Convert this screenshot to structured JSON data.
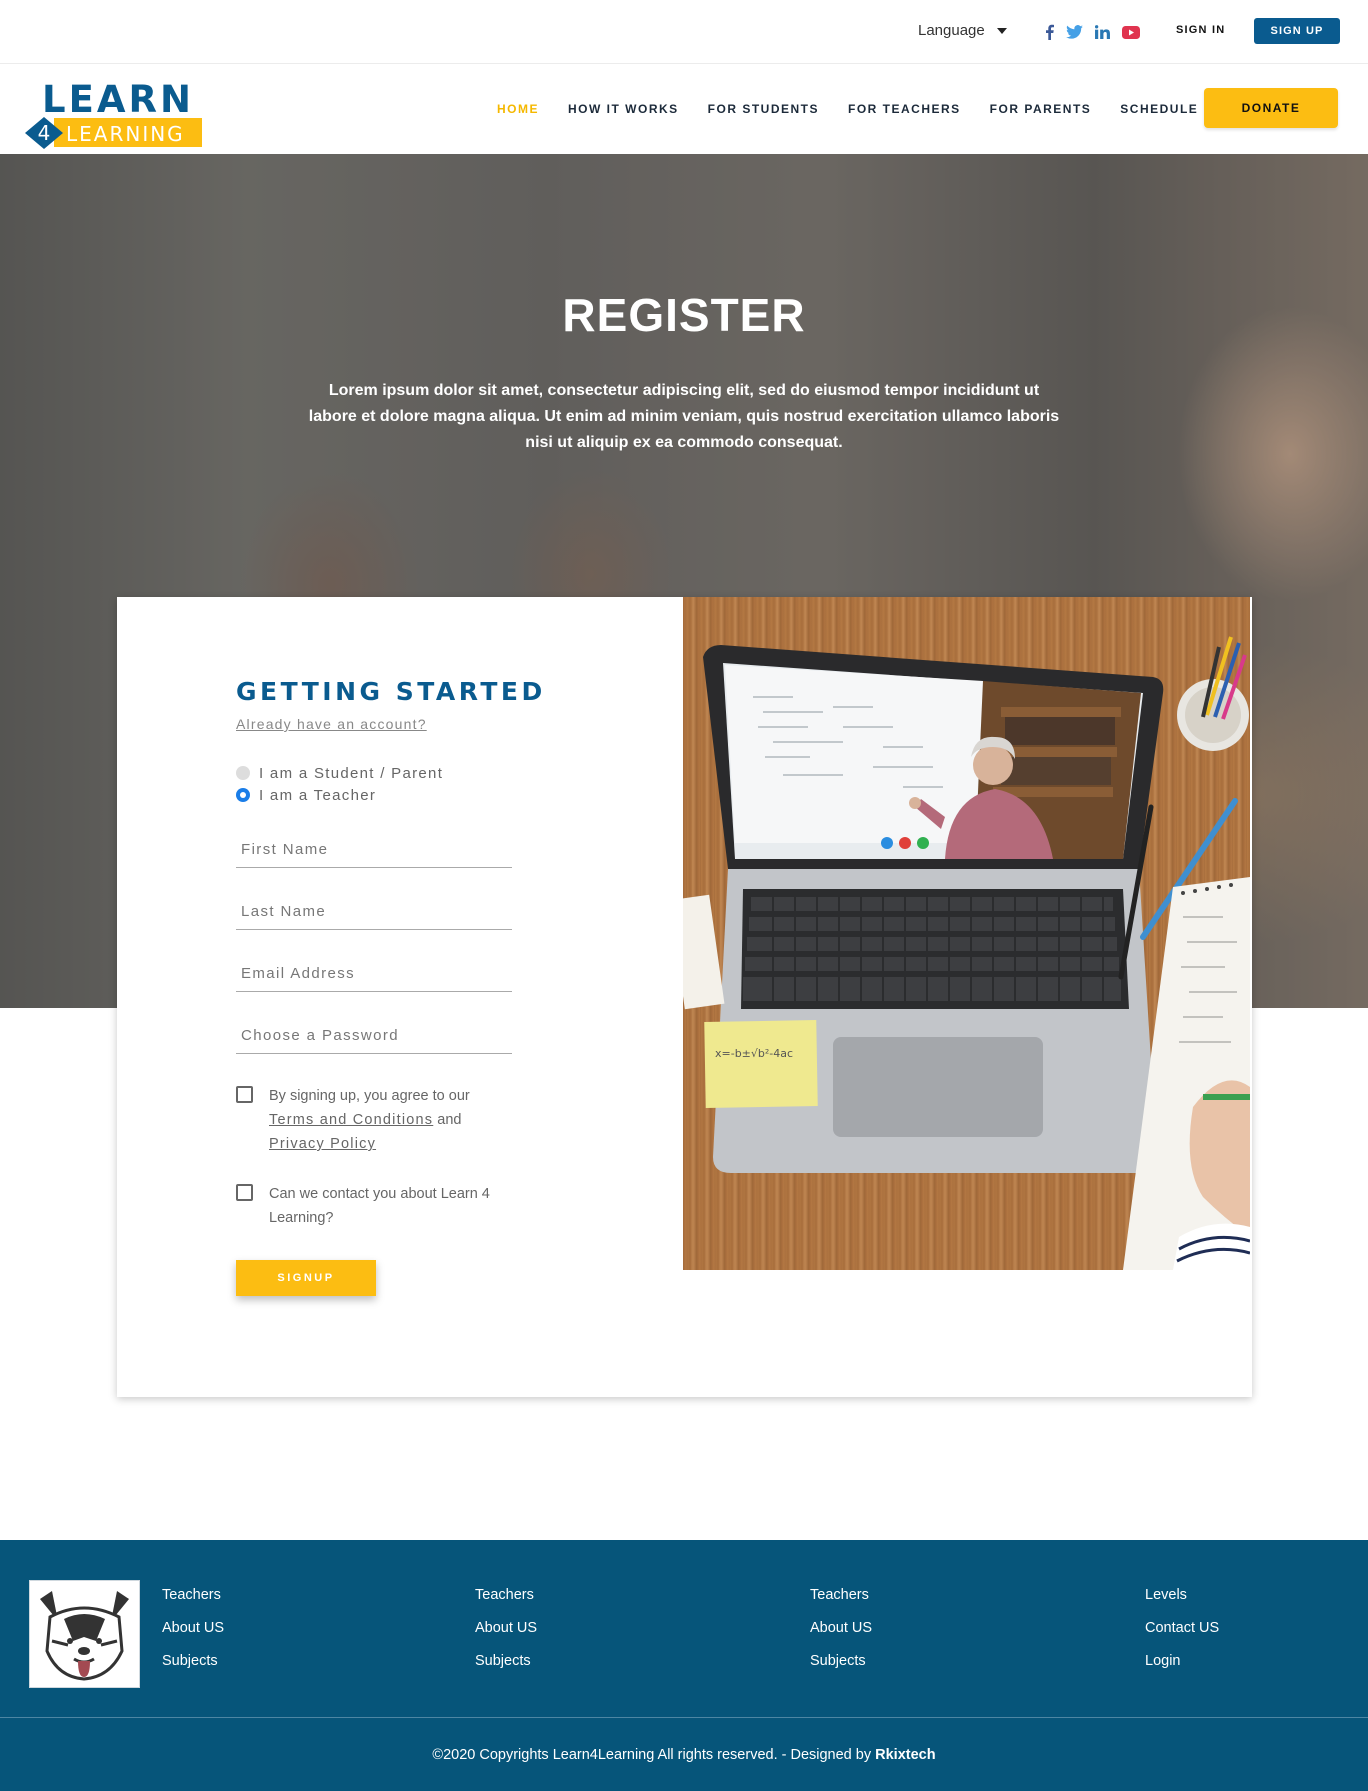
{
  "topbar": {
    "language_label": "Language",
    "social": [
      "facebook-icon",
      "twitter-icon",
      "linkedin-icon",
      "youtube-icon"
    ],
    "sign_in": "SIGN IN",
    "sign_up": "SIGN UP"
  },
  "nav": {
    "items": [
      {
        "label": "HOME",
        "active": true
      },
      {
        "label": "HOW IT WORKS",
        "active": false
      },
      {
        "label": "FOR STUDENTS",
        "active": false
      },
      {
        "label": "FOR TEACHERS",
        "active": false
      },
      {
        "label": "FOR PARENTS",
        "active": false
      },
      {
        "label": "SCHEDULE",
        "active": false
      }
    ],
    "donate": "DONATE"
  },
  "logo": {
    "top_text": "LEARN",
    "number": "4",
    "bottom_text": "LEARNING"
  },
  "hero": {
    "title": "REGISTER",
    "text": "Lorem ipsum dolor sit amet, consectetur adipiscing elit, sed do eiusmod tempor incididunt ut labore et dolore magna aliqua. Ut enim ad minim veniam, quis nostrud exercitation ullamco laboris nisi ut aliquip ex ea commodo consequat."
  },
  "form": {
    "title": "GETTING STARTED",
    "have_account": "Already have an account?",
    "radio_student": "I am a Student / Parent",
    "radio_teacher": "I am a Teacher",
    "selected_role": "teacher",
    "first_name_placeholder": "First Name",
    "last_name_placeholder": "Last Name",
    "email_placeholder": "Email Address",
    "password_placeholder": "Choose a Password",
    "terms_prefix": "By signing up, you agree to our",
    "terms_link": "Terms and Conditions",
    "terms_and": "and",
    "privacy_link": "Privacy Policy",
    "contact_text": "Can we contact you about Learn 4 Learning?",
    "signup_button": "SIGNUP"
  },
  "footer": {
    "col1": [
      "Teachers",
      "About US",
      "Subjects"
    ],
    "col2": [
      "Teachers",
      "About US",
      "Subjects"
    ],
    "col3": [
      "Teachers",
      "About US",
      "Subjects"
    ],
    "col4": [
      "Levels",
      "Contact US",
      "Login"
    ],
    "copyright": "©2020 Copyrights Learn4Learning All rights reserved.   -   Designed by",
    "designer": "Rkixtech"
  },
  "colors": {
    "brand_blue": "#0a5b8f",
    "accent_yellow": "#fcbd12",
    "footer_bg": "#06557a"
  }
}
